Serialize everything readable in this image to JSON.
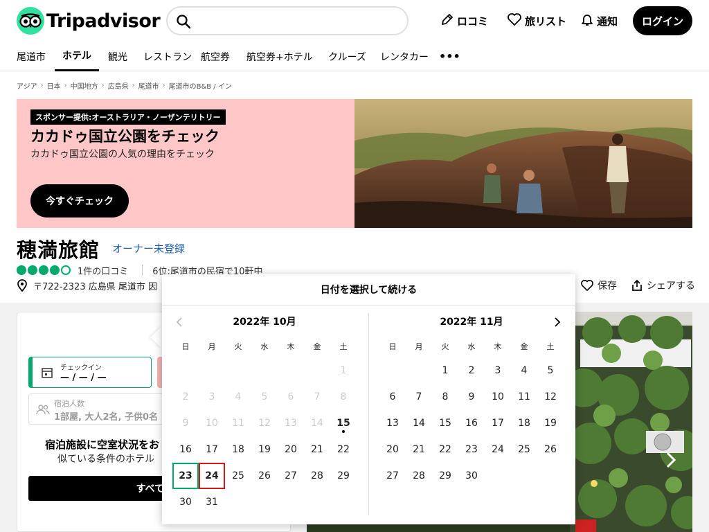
{
  "header": {
    "logo_text": "Tripadvisor",
    "search_placeholder": "",
    "links": {
      "review": "ロコミ",
      "trips": "旅リスト",
      "alerts": "通知"
    },
    "login_label": "ログイン"
  },
  "nav": {
    "items": [
      "尾道市",
      "ホテル",
      "観光",
      "レストラン",
      "航空券",
      "航空券+ホテル",
      "クルーズ",
      "レンタカー"
    ],
    "more": "•••"
  },
  "breadcrumb": [
    "アジア",
    "日本",
    "中国地方",
    "広島県",
    "尾道市",
    "尾道市のB&B / イン"
  ],
  "banner": {
    "sponsor_tag": "スポンサー提供:オーストラリア・ノーザンテリトリー",
    "title": "カカドゥ国立公園をチェック",
    "subtitle": "カカドゥ国立公園の人気の理由をチェック",
    "button": "今すぐチェック"
  },
  "property": {
    "name": "穂満旅館",
    "owner_link": "オーナー未登録",
    "rating": 4,
    "rating_max": 5,
    "review_count": "1件の口コミ",
    "ranking": "6位:尾道市の民宿で10軒中",
    "address": "〒722-2323 広島県 尾道市 因",
    "save": "保存",
    "share": "シェアする"
  },
  "booking": {
    "checkin_label": "チェックイン",
    "checkin_value": "— / — / —",
    "guests_label": "宿泊人数",
    "guests_value": "1部屋, 大人2名, 子供0名",
    "availability_title": "宿泊施設に空室状況をお",
    "availability_sub": "似ている条件のホテル",
    "all_button": "すべて表"
  },
  "calendar": {
    "header": "日付を選択して続ける",
    "weekdays": [
      "日",
      "月",
      "火",
      "水",
      "木",
      "金",
      "土"
    ],
    "months": [
      {
        "title": "2022年 10月",
        "rows": [
          [
            "",
            "",
            "",
            "",
            "",
            "",
            "1"
          ],
          [
            "2",
            "3",
            "4",
            "5",
            "6",
            "7",
            "8"
          ],
          [
            "9",
            "10",
            "11",
            "12",
            "13",
            "14",
            "15"
          ],
          [
            "16",
            "17",
            "18",
            "19",
            "20",
            "21",
            "22"
          ],
          [
            "23",
            "24",
            "25",
            "26",
            "27",
            "28",
            "29"
          ],
          [
            "30",
            "31",
            "",
            "",
            "",
            "",
            ""
          ]
        ],
        "disabled_before": 15,
        "today": 15,
        "checkin": 23,
        "checkout": 24
      },
      {
        "title": "2022年 11月",
        "rows": [
          [
            "",
            "",
            "1",
            "2",
            "3",
            "4",
            "5"
          ],
          [
            "6",
            "7",
            "8",
            "9",
            "10",
            "11",
            "12"
          ],
          [
            "13",
            "14",
            "15",
            "16",
            "17",
            "18",
            "19"
          ],
          [
            "20",
            "21",
            "22",
            "23",
            "24",
            "25",
            "26"
          ],
          [
            "27",
            "28",
            "29",
            "30",
            "",
            "",
            ""
          ]
        ]
      }
    ]
  },
  "colors": {
    "brand_green": "#34e0a1",
    "rating_green": "#00aa6c",
    "checkout_red": "#d11a1a",
    "banner_pink": "#ffc7c7",
    "link_blue": "#1a5db5"
  }
}
